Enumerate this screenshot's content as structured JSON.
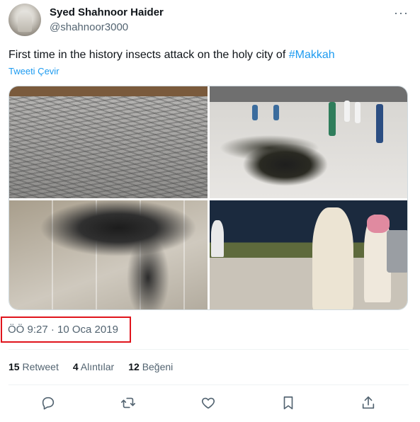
{
  "tweet": {
    "display_name": "Syed Shahnoor Haider",
    "handle": "@shahnoor3000",
    "text_before": "First time in the history insects attack on the holy city of ",
    "hashtag": "#Makkah",
    "translate_label": "Tweeti Çevir",
    "timestamp": "ÖÖ 9:27 · 10 Oca 2019"
  },
  "stats": {
    "retweets_count": "15",
    "retweets_label": "Retweet",
    "quotes_count": "4",
    "quotes_label": "Alıntılar",
    "likes_count": "12",
    "likes_label": "Beğeni"
  },
  "actions": [
    "reply-icon",
    "retweet-icon",
    "like-icon",
    "bookmark-icon",
    "share-icon"
  ],
  "colors": {
    "accent": "#1d9bf0",
    "muted": "#536471",
    "highlight": "#e0141c"
  }
}
